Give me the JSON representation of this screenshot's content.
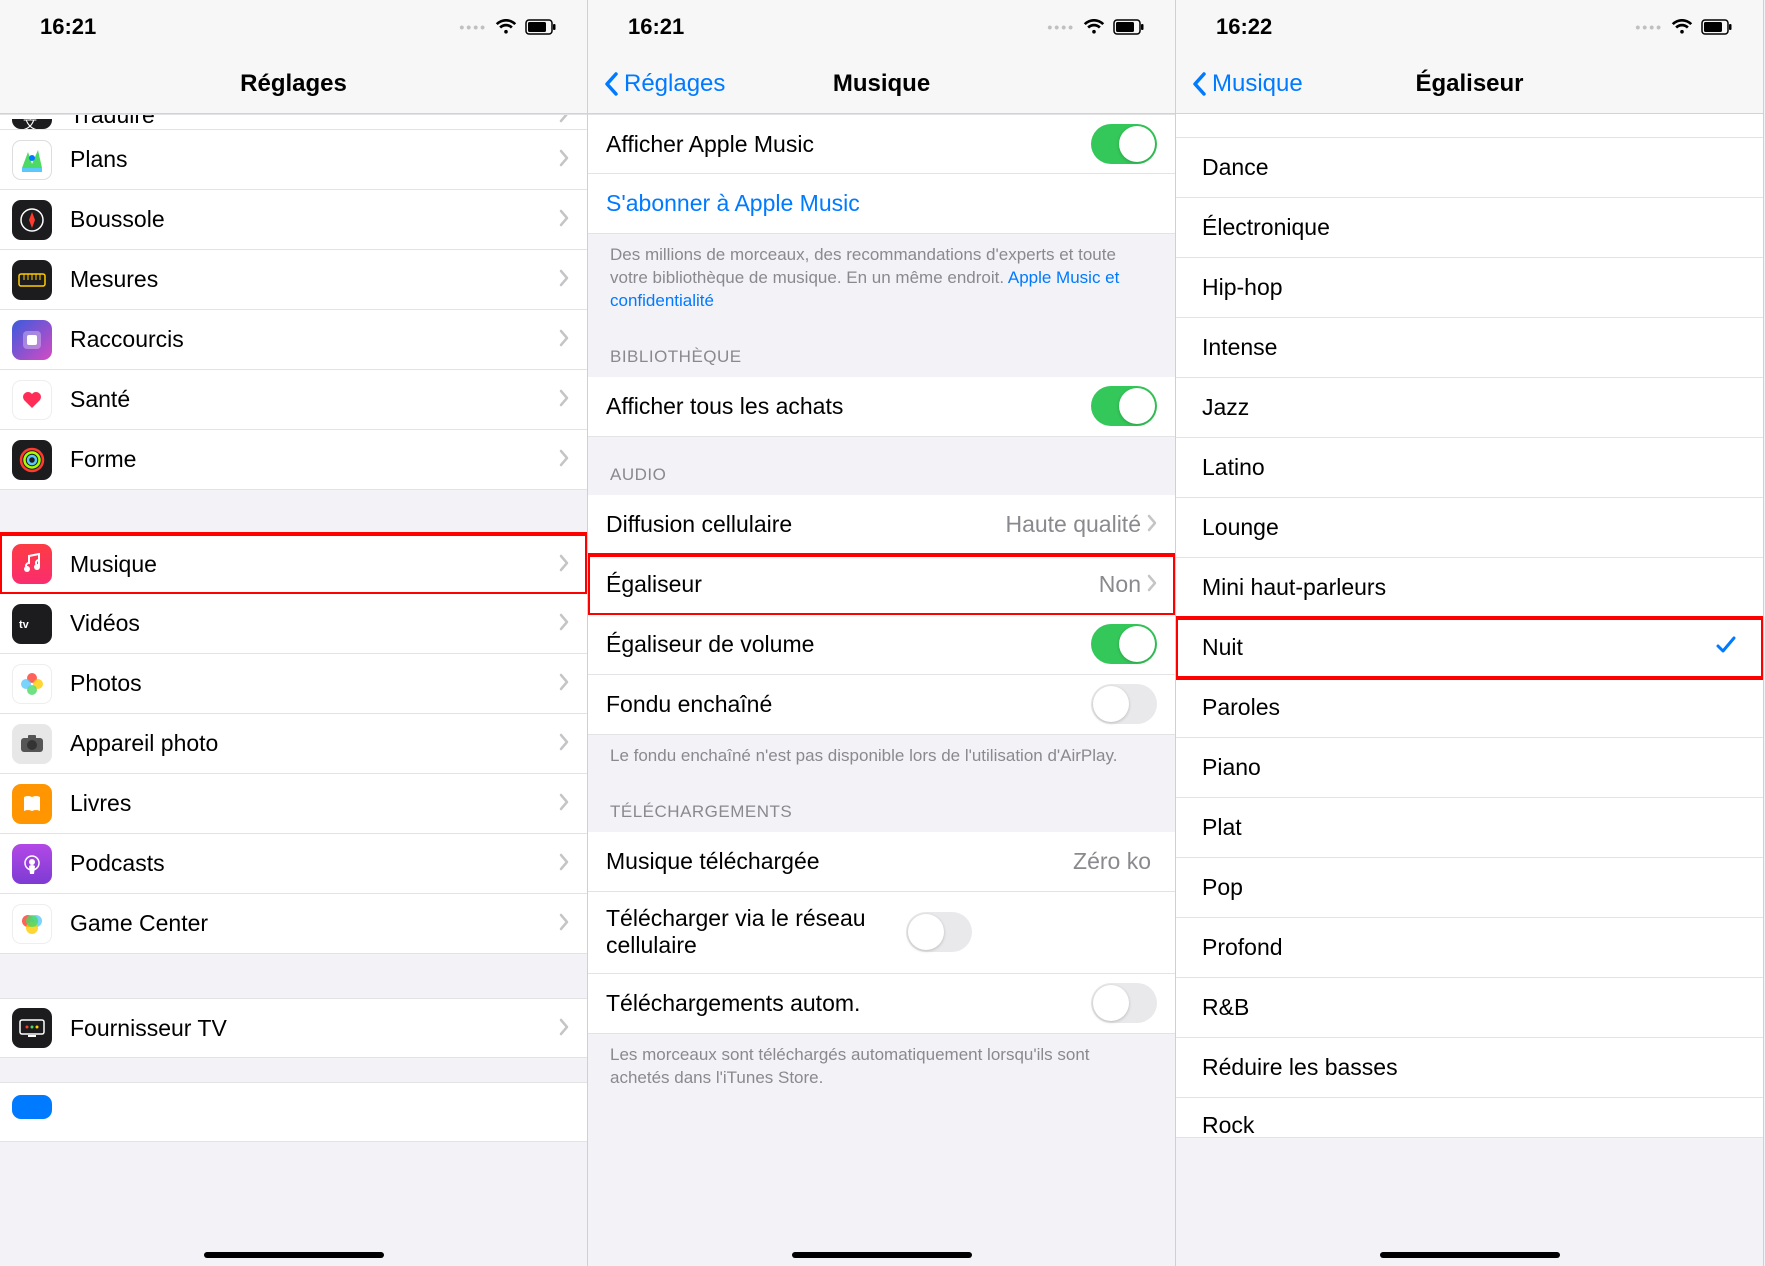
{
  "screen1": {
    "time": "16:21",
    "title": "Réglages",
    "items": [
      {
        "label": "Traduire",
        "icon": "translate"
      },
      {
        "label": "Plans",
        "icon": "plans"
      },
      {
        "label": "Boussole",
        "icon": "boussole"
      },
      {
        "label": "Mesures",
        "icon": "mesures"
      },
      {
        "label": "Raccourcis",
        "icon": "raccourcis"
      },
      {
        "label": "Santé",
        "icon": "sante"
      },
      {
        "label": "Forme",
        "icon": "forme"
      }
    ],
    "items2": [
      {
        "label": "Musique",
        "icon": "musique",
        "highlight": true
      },
      {
        "label": "Vidéos",
        "icon": "videos"
      },
      {
        "label": "Photos",
        "icon": "photos"
      },
      {
        "label": "Appareil photo",
        "icon": "camera"
      },
      {
        "label": "Livres",
        "icon": "livres"
      },
      {
        "label": "Podcasts",
        "icon": "podcasts"
      },
      {
        "label": "Game Center",
        "icon": "gamecenter"
      }
    ],
    "items3": [
      {
        "label": "Fournisseur TV",
        "icon": "tv"
      }
    ]
  },
  "screen2": {
    "time": "16:21",
    "back": "Réglages",
    "title": "Musique",
    "row_show_am": "Afficher Apple Music",
    "row_subscribe": "S'abonner à Apple Music",
    "footer1a": "Des millions de morceaux, des recommandations d'experts et toute votre bibliothèque de musique. En un même endroit. ",
    "footer1b": "Apple Music et confidentialité",
    "header_lib": "BIBLIOTHÈQUE",
    "row_show_purchases": "Afficher tous les achats",
    "header_audio": "AUDIO",
    "row_cell_stream": "Diffusion cellulaire",
    "val_cell_stream": "Haute qualité",
    "row_eq": "Égaliseur",
    "val_eq": "Non",
    "row_vol_eq": "Égaliseur de volume",
    "row_crossfade": "Fondu enchaîné",
    "footer_audio": "Le fondu enchaîné n'est pas disponible lors de l'utilisation d'AirPlay.",
    "header_dl": "TÉLÉCHARGEMENTS",
    "row_dl_music": "Musique téléchargée",
    "val_dl_music": "Zéro ko",
    "row_dl_cell": "Télécharger via le réseau cellulaire",
    "row_dl_auto": "Téléchargements autom.",
    "footer_dl": "Les morceaux sont téléchargés automatiquement lorsqu'ils sont achetés dans l'iTunes Store."
  },
  "screen3": {
    "time": "16:22",
    "back": "Musique",
    "title": "Égaliseur",
    "options": [
      "Dance",
      "Électronique",
      "Hip-hop",
      "Intense",
      "Jazz",
      "Latino",
      "Lounge",
      "Mini haut-parleurs",
      "Nuit",
      "Paroles",
      "Piano",
      "Plat",
      "Pop",
      "Profond",
      "R&B",
      "Réduire les basses",
      "Rock"
    ],
    "selected": "Nuit",
    "highlight": "Nuit"
  }
}
